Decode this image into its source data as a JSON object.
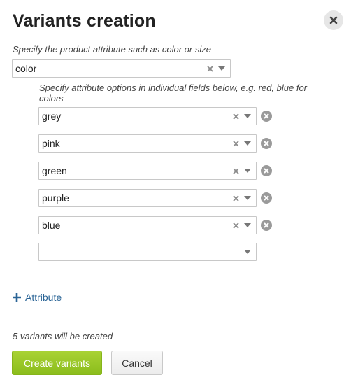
{
  "dialog": {
    "title": "Variants creation",
    "close_icon": "close-icon"
  },
  "attribute": {
    "hint": "Specify the product attribute such as color or size",
    "value": "color"
  },
  "options": {
    "hint": "Specify attribute options in individual fields below, e.g. red, blue for colors",
    "items": [
      "grey",
      "pink",
      "green",
      "purple",
      "blue"
    ],
    "empty_value": ""
  },
  "add_attribute_label": "Attribute",
  "summary": "5 variants will be created",
  "buttons": {
    "create": "Create variants",
    "cancel": "Cancel"
  },
  "colors": {
    "link": "#2a6496",
    "primary_button": "#93c524",
    "icon_gray": "#8c8c8c"
  }
}
